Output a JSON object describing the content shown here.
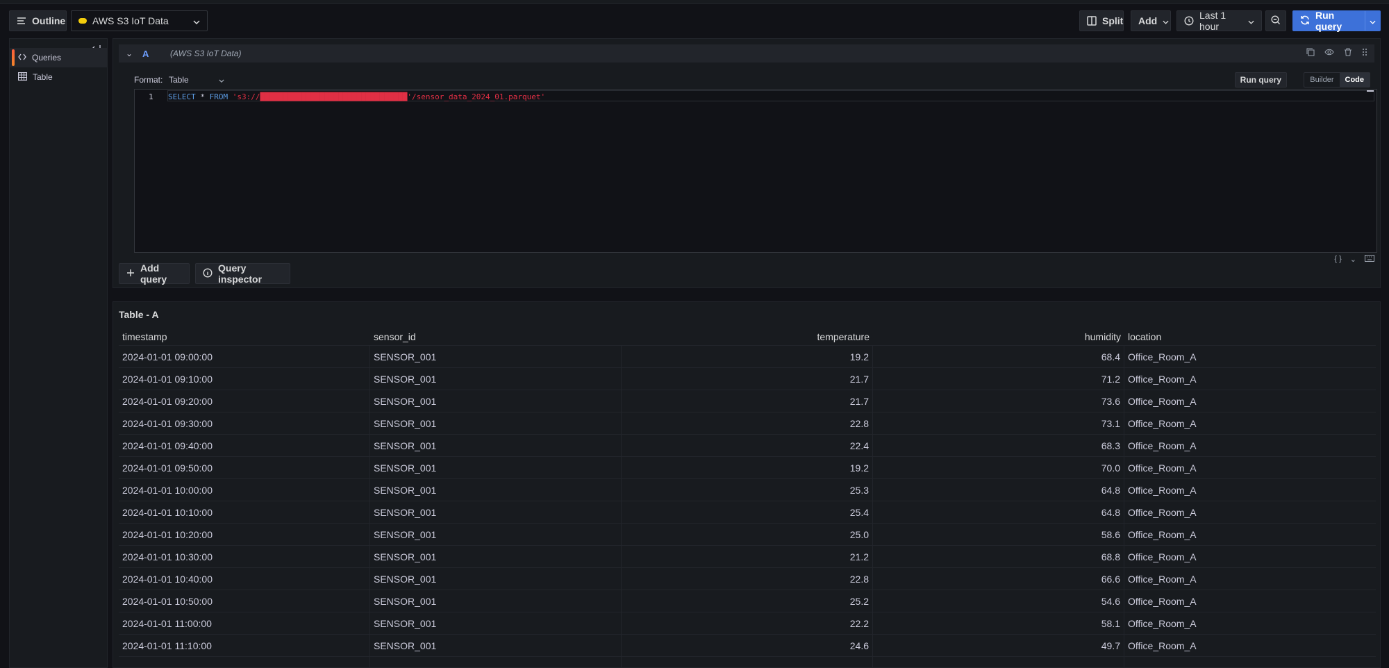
{
  "toolbar": {
    "outline_label": "Outline",
    "datasource_label": "AWS S3 IoT Data",
    "split_label": "Split",
    "add_label": "Add",
    "time_range_label": "Last 1 hour",
    "run_query_label": "Run query"
  },
  "sidebar": {
    "items": [
      {
        "label": "Queries",
        "icon": "code-brackets-icon",
        "active": true
      },
      {
        "label": "Table",
        "icon": "table-icon",
        "active": false
      }
    ]
  },
  "query": {
    "ref_id": "A",
    "datasource": "(AWS S3 IoT Data)",
    "format_label": "Format:",
    "format_value": "Table",
    "run_query_label": "Run query",
    "mode_builder": "Builder",
    "mode_code": "Code",
    "line_number": "1",
    "sql_select": "SELECT",
    "sql_star": "*",
    "sql_from": "FROM",
    "sql_path_prefix": "'s3://████████████████████████████████",
    "sql_path_suffix": "'/sensor_data_2024_01.parquet'",
    "add_query_label": "Add query",
    "query_inspector_label": "Query inspector"
  },
  "table": {
    "title": "Table - A",
    "columns": [
      "timestamp",
      "sensor_id",
      "temperature",
      "humidity",
      "location"
    ],
    "rows": [
      [
        "2024-01-01 09:00:00",
        "SENSOR_001",
        "19.2",
        "68.4",
        "Office_Room_A"
      ],
      [
        "2024-01-01 09:10:00",
        "SENSOR_001",
        "21.7",
        "71.2",
        "Office_Room_A"
      ],
      [
        "2024-01-01 09:20:00",
        "SENSOR_001",
        "21.7",
        "73.6",
        "Office_Room_A"
      ],
      [
        "2024-01-01 09:30:00",
        "SENSOR_001",
        "22.8",
        "73.1",
        "Office_Room_A"
      ],
      [
        "2024-01-01 09:40:00",
        "SENSOR_001",
        "22.4",
        "68.3",
        "Office_Room_A"
      ],
      [
        "2024-01-01 09:50:00",
        "SENSOR_001",
        "19.2",
        "70.0",
        "Office_Room_A"
      ],
      [
        "2024-01-01 10:00:00",
        "SENSOR_001",
        "25.3",
        "64.8",
        "Office_Room_A"
      ],
      [
        "2024-01-01 10:10:00",
        "SENSOR_001",
        "25.4",
        "64.8",
        "Office_Room_A"
      ],
      [
        "2024-01-01 10:20:00",
        "SENSOR_001",
        "25.0",
        "58.6",
        "Office_Room_A"
      ],
      [
        "2024-01-01 10:30:00",
        "SENSOR_001",
        "21.2",
        "68.8",
        "Office_Room_A"
      ],
      [
        "2024-01-01 10:40:00",
        "SENSOR_001",
        "22.8",
        "66.6",
        "Office_Room_A"
      ],
      [
        "2024-01-01 10:50:00",
        "SENSOR_001",
        "25.2",
        "54.6",
        "Office_Room_A"
      ],
      [
        "2024-01-01 11:00:00",
        "SENSOR_001",
        "22.2",
        "58.1",
        "Office_Room_A"
      ],
      [
        "2024-01-01 11:10:00",
        "SENSOR_001",
        "24.6",
        "49.7",
        "Office_Room_A"
      ],
      [
        "",
        "",
        "",
        "",
        ""
      ]
    ]
  },
  "colors": {
    "accent_blue": "#3d71d9",
    "sql_keyword": "#5d9de6",
    "sql_string": "#e02f44",
    "active_nav_bar": "#ff5f3c",
    "datasource_dot": "#f2cc0c"
  }
}
